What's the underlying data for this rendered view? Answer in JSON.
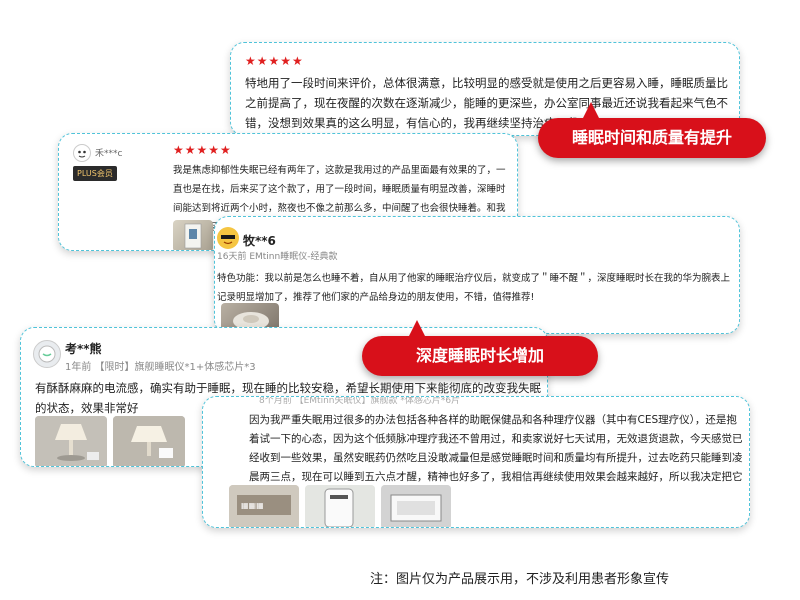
{
  "reviews": [
    {
      "stars": "★★★★★",
      "text": "特地用了一段时间来评价，总体很满意，比较明显的感受就是使用之后更容易入睡，睡眠质量比之前提高了，现在夜醒的次数在逐渐减少，能睡的更深些，办公室同事最近还说我看起来气色不错，没想到效果真的这么明显，有信心的，我再继续坚持治疗一段时间。"
    },
    {
      "user": "禾***c",
      "badge": "PLUS会员",
      "stars": "★★★★★",
      "text": "我是焦虑抑郁性失眠已经有两年了，这款是我用过的产品里面最有效果的了，一直也是在找，后来买了这个款了，用了一段时间，睡眠质量有明显改善，深睡时间能达到将近两个小时，熬夜也不像之前那么多，中间醒了也会很快睡着。和我有一样的困扰的朋友可以试一下。"
    },
    {
      "user": "牧**6",
      "meta": "16天前 EMtinn睡眠仪-经典款",
      "text": "特色功能：我以前是怎么也睡不着，自从用了他家的睡眠治疗仪后，就变成了＂睡不醒＂，深度睡眠时长在我的华为腕表上记录明显增加了，推荐了他们家的产品给身边的朋友使用，不错，值得推荐!"
    },
    {
      "user": "考**熊",
      "meta": "1年前 【限时】旗舰睡眠仪*1+体感芯片*3",
      "text": "有酥酥麻麻的电流感，确实有助于睡眠，现在睡的比较安稳，希望长期使用下来能彻底的改变我失眠的状态，效果非常好"
    },
    {
      "meta": "8个月前 【EMtinn失眠仪】旗舰款 *体感芯片*6片",
      "text": "因为我严重失眠用过很多的办法包括各种各样的助眠保健品和各种理疗仪器（其中有CES理疗仪），还是抱着试一下的心态，因为这个低频脉冲理疗我还不曾用过，和卖家说好七天试用，无效退货退款，今天感觉已经收到一些效果，虽然安眠药仍然吃且没敢减量但是感觉睡眠时间和质量均有所提升，过去吃药只能睡到凌晨两三点，现在可以睡到五六点才醒，精神也好多了，我相信再继续使用效果会越来越好，所以我决定把它留下。感谢客服细心耐心的讲解。"
    }
  ],
  "callouts": {
    "first": "睡眠时间和质量有提升",
    "second": "深度睡眠时长增加"
  },
  "disclaimer": "注：图片仅为产品展示用，不涉及利用患者形象宣传",
  "colors": {
    "accent": "#d8101a",
    "border": "#4fc3d9",
    "star": "#e02020"
  }
}
